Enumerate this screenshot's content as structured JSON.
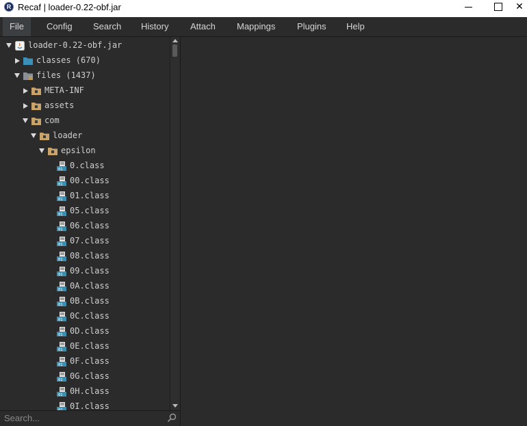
{
  "window": {
    "title": "Recaf | loader-0.22-obf.jar",
    "app_icon_glyph": "R",
    "close_glyph": "✕"
  },
  "menu": {
    "items": [
      "File",
      "Config",
      "Search",
      "History",
      "Attach",
      "Mappings",
      "Plugins",
      "Help"
    ],
    "active": "File"
  },
  "tree": {
    "nodes": [
      {
        "label": "loader-0.22-obf.jar",
        "icon": "jar-icon",
        "expanded": true
      },
      {
        "label": "classes (670)",
        "icon": "folder-blue-icon",
        "expanded": false
      },
      {
        "label": "files (1437)",
        "icon": "folder-files-icon",
        "expanded": true
      },
      {
        "label": "META-INF",
        "icon": "package-folder-icon",
        "expanded": false
      },
      {
        "label": "assets",
        "icon": "package-folder-icon",
        "expanded": false
      },
      {
        "label": "com",
        "icon": "package-folder-icon",
        "expanded": true
      },
      {
        "label": "loader",
        "icon": "package-folder-icon",
        "expanded": true
      },
      {
        "label": "epsilon",
        "icon": "package-folder-icon",
        "expanded": true
      },
      {
        "label": "0.class",
        "icon": "class-file-icon"
      },
      {
        "label": "00.class",
        "icon": "class-file-icon"
      },
      {
        "label": "01.class",
        "icon": "class-file-icon"
      },
      {
        "label": "05.class",
        "icon": "class-file-icon"
      },
      {
        "label": "06.class",
        "icon": "class-file-icon"
      },
      {
        "label": "07.class",
        "icon": "class-file-icon"
      },
      {
        "label": "08.class",
        "icon": "class-file-icon"
      },
      {
        "label": "09.class",
        "icon": "class-file-icon"
      },
      {
        "label": "0A.class",
        "icon": "class-file-icon"
      },
      {
        "label": "0B.class",
        "icon": "class-file-icon"
      },
      {
        "label": "0C.class",
        "icon": "class-file-icon"
      },
      {
        "label": "0D.class",
        "icon": "class-file-icon"
      },
      {
        "label": "0E.class",
        "icon": "class-file-icon"
      },
      {
        "label": "0F.class",
        "icon": "class-file-icon"
      },
      {
        "label": "0G.class",
        "icon": "class-file-icon"
      },
      {
        "label": "0H.class",
        "icon": "class-file-icon"
      },
      {
        "label": "0I.class",
        "icon": "class-file-icon"
      }
    ]
  },
  "search": {
    "placeholder": "Search..."
  },
  "colors": {
    "background": "#2b2b2b",
    "text": "#d0d0d0",
    "folder_blue": "#3d8fb8",
    "folder_tan": "#c8a46a",
    "class_icon_teal": "#3b8fb0"
  }
}
